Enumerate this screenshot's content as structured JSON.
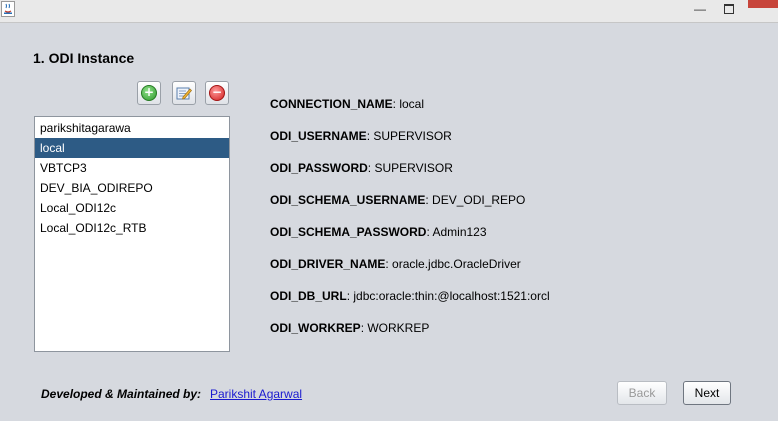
{
  "window": {
    "minimize_glyph": "—",
    "app_icon": "java-icon"
  },
  "section": {
    "title": "1. ODI Instance"
  },
  "toolbar": {
    "add_icon": "add-icon",
    "edit_icon": "edit-icon",
    "delete_icon": "delete-icon",
    "add_glyph": "+",
    "delete_glyph": "−"
  },
  "instances": {
    "items": [
      "parikshitagarawa",
      "local",
      "VBTCP3",
      "DEV_BIA_ODIREPO",
      "Local_ODI12c",
      "Local_ODI12c_RTB"
    ],
    "selected_index": 1
  },
  "details": [
    {
      "key": "CONNECTION_NAME",
      "value": ": local"
    },
    {
      "key": "ODI_USERNAME",
      "value": ": SUPERVISOR"
    },
    {
      "key": "ODI_PASSWORD",
      "value": ": SUPERVISOR"
    },
    {
      "key": "ODI_SCHEMA_USERNAME",
      "value": ": DEV_ODI_REPO"
    },
    {
      "key": "ODI_SCHEMA_PASSWORD",
      "value": ": Admin123"
    },
    {
      "key": "ODI_DRIVER_NAME",
      "value": ": oracle.jdbc.OracleDriver"
    },
    {
      "key": "ODI_DB_URL",
      "value": ": jdbc:oracle:thin:@localhost:1521:orcl"
    },
    {
      "key": "ODI_WORKREP",
      "value": ": WORKREP"
    }
  ],
  "footer": {
    "label": "Developed & Maintained by:",
    "author_link": "Parikshit Agarwal"
  },
  "buttons": {
    "back": "Back",
    "next": "Next"
  }
}
